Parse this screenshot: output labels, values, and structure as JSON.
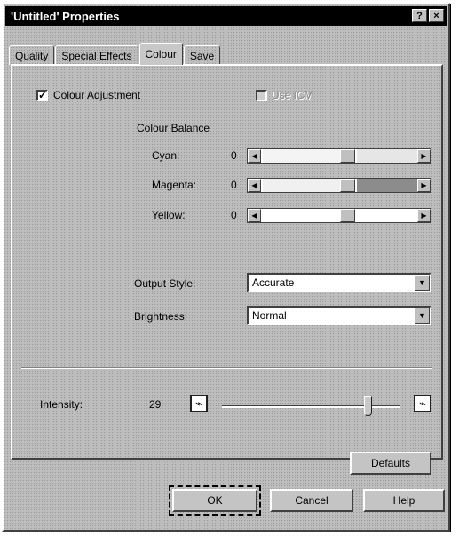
{
  "window": {
    "title": "'Untitled' Properties",
    "help_glyph": "?",
    "close_glyph": "×"
  },
  "tabs": [
    {
      "label": "Quality"
    },
    {
      "label": "Special Effects"
    },
    {
      "label": "Colour",
      "active": true
    },
    {
      "label": "Save"
    }
  ],
  "colour_adjustment": {
    "label": "Colour Adjustment",
    "checked": true,
    "mark": "✓"
  },
  "use_icm": {
    "label": "Use ICM",
    "checked": false,
    "disabled": true
  },
  "colour_balance": {
    "heading": "Colour Balance",
    "rows": [
      {
        "label": "Cyan:",
        "value": "0",
        "position": 0.5
      },
      {
        "label": "Magenta:",
        "value": "0",
        "position": 0.5
      },
      {
        "label": "Yellow:",
        "value": "0",
        "position": 0.5
      }
    ]
  },
  "output_style": {
    "label": "Output Style:",
    "value": "Accurate"
  },
  "brightness": {
    "label": "Brightness:",
    "value": "Normal"
  },
  "intensity": {
    "label": "Intensity:",
    "value": "29",
    "position": 0.84
  },
  "buttons": {
    "defaults": "Defaults",
    "ok": "OK",
    "cancel": "Cancel",
    "help": "Help"
  },
  "glyphs": {
    "left": "◀",
    "right": "▶",
    "down": "▼"
  }
}
